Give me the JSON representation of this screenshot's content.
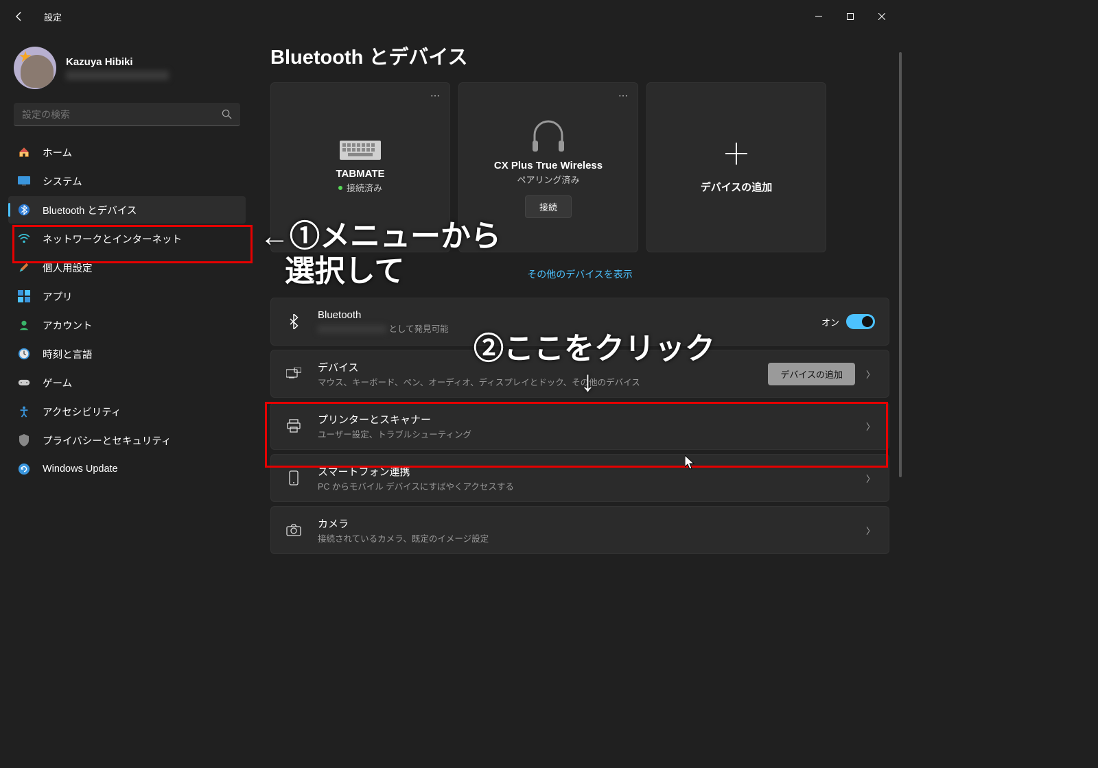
{
  "window": {
    "title": "設定"
  },
  "user": {
    "name": "Kazuya Hibiki"
  },
  "search": {
    "placeholder": "設定の検索"
  },
  "nav": {
    "home": "ホーム",
    "system": "システム",
    "bluetooth": "Bluetooth とデバイス",
    "network": "ネットワークとインターネット",
    "personal": "個人用設定",
    "apps": "アプリ",
    "account": "アカウント",
    "time": "時刻と言語",
    "game": "ゲーム",
    "accessibility": "アクセシビリティ",
    "privacy": "プライバシーとセキュリティ",
    "update": "Windows Update"
  },
  "page": {
    "title": "Bluetooth とデバイス"
  },
  "devices": [
    {
      "name": "TABMATE",
      "status": "接続済み"
    },
    {
      "name": "CX Plus True Wireless",
      "status": "ペアリング済み",
      "connect": "接続"
    }
  ],
  "add_device": "デバイスの追加",
  "show_more": "その他のデバイスを表示",
  "bt_row": {
    "title": "Bluetooth",
    "sub": "として発見可能",
    "toggle": "オン"
  },
  "rows": {
    "devices": {
      "title": "デバイス",
      "sub": "マウス、キーボード、ペン、オーディオ、ディスプレイとドック、その他のデバイス",
      "btn": "デバイスの追加"
    },
    "printers": {
      "title": "プリンターとスキャナー",
      "sub": "ユーザー設定、トラブルシューティング"
    },
    "phone": {
      "title": "スマートフォン連携",
      "sub": "PC からモバイル デバイスにすばやくアクセスする"
    },
    "camera": {
      "title": "カメラ",
      "sub": "接続されているカメラ、既定のイメージ設定"
    }
  },
  "annotations": {
    "a1_line1": "←①メニューから",
    "a1_line2": "選択して",
    "a2": "②ここをクリック",
    "arrow": "↓"
  }
}
